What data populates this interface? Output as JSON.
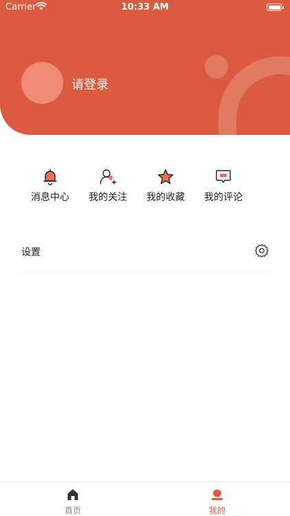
{
  "status_bar": {
    "carrier": "Carrier",
    "time": "10:33 AM"
  },
  "profile": {
    "login_text": "请登录"
  },
  "quick_menu": [
    {
      "label": "消息中心",
      "icon": "bell-icon"
    },
    {
      "label": "我的关注",
      "icon": "follow-user-icon"
    },
    {
      "label": "我的收藏",
      "icon": "star-icon"
    },
    {
      "label": "我的评论",
      "icon": "comment-icon"
    }
  ],
  "settings": {
    "label": "设置",
    "icon": "gear-icon"
  },
  "tabbar": {
    "home": {
      "label": "首页",
      "icon": "home-icon"
    },
    "mine": {
      "label": "我的",
      "icon": "user-icon",
      "selected": true
    }
  },
  "colors": {
    "accent": "#dc5a40",
    "avatar": "#f28a76",
    "deco": "#e27a63"
  }
}
